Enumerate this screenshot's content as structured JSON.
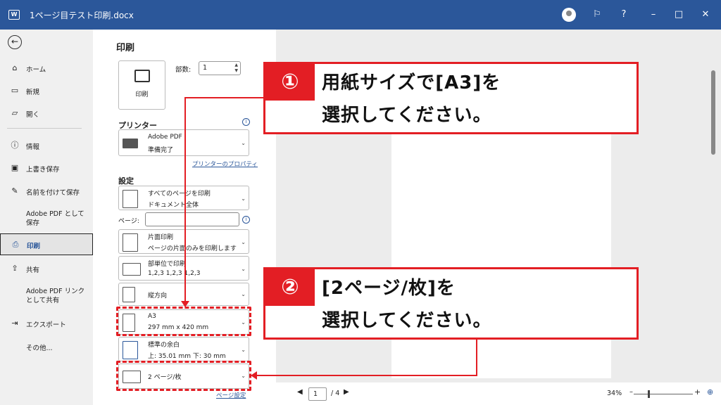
{
  "titlebar": {
    "title": "1ページ目テスト印刷.docx",
    "help": "?",
    "minimize": "–",
    "maximize": "□",
    "close": "✕"
  },
  "sidebar": {
    "items": [
      {
        "label": "ホーム",
        "icon": "home-icon"
      },
      {
        "label": "新規",
        "icon": "new-document-icon"
      },
      {
        "label": "開く",
        "icon": "folder-open-icon"
      },
      {
        "label": "情報",
        "icon": "info-icon"
      },
      {
        "label": "上書き保存",
        "icon": "save-icon"
      },
      {
        "label": "名前を付けて保存",
        "icon": "save-as-icon"
      },
      {
        "label": "Adobe PDF として保存"
      },
      {
        "label": "印刷",
        "icon": "printer-icon",
        "active": true
      },
      {
        "label": "共有",
        "icon": "share-icon"
      },
      {
        "label": "Adobe PDF リンクとして共有"
      },
      {
        "label": "エクスポート",
        "icon": "export-icon"
      },
      {
        "label": "その他..."
      }
    ]
  },
  "print": {
    "heading": "印刷",
    "print_button": "印刷",
    "copies_label": "部数:",
    "copies_value": "1",
    "printer_heading": "プリンター",
    "printer_name": "Adobe PDF",
    "printer_status": "準備完了",
    "printer_properties": "プリンターのプロパティ",
    "settings_heading": "設定",
    "pages_label": "ページ:",
    "page_setup": "ページ設定",
    "settings": [
      {
        "line1": "すべてのページを印刷",
        "line2": "ドキュメント全体"
      },
      {
        "line1": "片面印刷",
        "line2": "ページの片面のみを印刷します"
      },
      {
        "line1": "部単位で印刷",
        "line2": "1,2,3    1,2,3    1,2,3"
      },
      {
        "line1": "縦方向",
        "line2": ""
      },
      {
        "line1": "A3",
        "line2": "297 mm x 420 mm"
      },
      {
        "line1": "標準の余白",
        "line2": "上: 35.01 mm 下: 30 mm"
      },
      {
        "line1": "2 ページ/枚",
        "line2": ""
      }
    ]
  },
  "preview": {
    "page_current": "1",
    "page_total": "/ 4",
    "zoom": "34%"
  },
  "callouts": [
    {
      "number": "①",
      "line1": "用紙サイズで[A3]を",
      "line2": "選択してください。"
    },
    {
      "number": "②",
      "line1": "[2ページ/枚]を",
      "line2": "選択してください。"
    }
  ],
  "colors": {
    "titlebar": "#2b579a",
    "highlight": "#e31e24"
  }
}
